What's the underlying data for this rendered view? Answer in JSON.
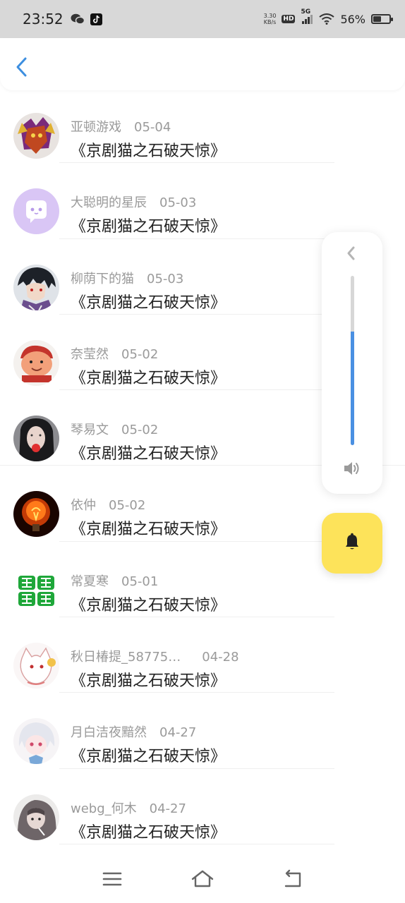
{
  "status_bar": {
    "time": "23:52",
    "left_icons": [
      "wechat-icon",
      "tiktok-icon"
    ],
    "net_speed_value": "3.30",
    "net_speed_unit": "KB/s",
    "hd_label": "HD",
    "network": "5G",
    "battery": "56%",
    "battery_level": 0.56
  },
  "header": {
    "back_icon": "chevron-left-icon"
  },
  "comments": [
    {
      "name": "亚顿游戏",
      "date": "05-04",
      "title": "《京剧猫之石破天惊》",
      "avatar": "game-character-avatar"
    },
    {
      "name": "大聪明的星辰",
      "date": "05-03",
      "title": "《京剧猫之石破天惊》",
      "avatar": "default-purple-avatar"
    },
    {
      "name": "柳荫下的猫",
      "date": "05-03",
      "title": "《京剧猫之石破天惊》",
      "avatar": "anime-boy-avatar"
    },
    {
      "name": "奈莹然",
      "date": "05-02",
      "title": "《京剧猫之石破天惊》",
      "avatar": "cartoon-face-avatar"
    },
    {
      "name": "琴易文",
      "date": "05-02",
      "title": "《京剧猫之石破天惊》",
      "avatar": "girl-photo-avatar"
    },
    {
      "name": "依仲",
      "date": "05-02",
      "title": "《京剧猫之石破天惊》",
      "avatar": "light-bulb-avatar"
    },
    {
      "name": "常夏寒",
      "date": "05-01",
      "title": "《京剧猫之石破天惊》",
      "avatar": "bbq-text-avatar",
      "avatar_text": "烧烤联盟"
    },
    {
      "name": "秋日椿提_58775…",
      "date": "04-28",
      "title": "《京剧猫之石破天惊》",
      "avatar": "white-creature-avatar"
    },
    {
      "name": "月白洁夜黯然",
      "date": "04-27",
      "title": "《京剧猫之石破天惊》",
      "avatar": "anime-girl-avatar"
    },
    {
      "name": "webg_何木",
      "date": "04-27",
      "title": "《京剧猫之石破天惊》",
      "avatar": "sketch-girl-avatar"
    }
  ],
  "volume_panel": {
    "level": 0.67,
    "collapse_icon": "chevron-left-icon",
    "speaker_icon": "speaker-icon"
  },
  "bell_button": {
    "icon": "bell-icon"
  },
  "nav_bar": {
    "buttons": [
      "menu-icon",
      "home-icon",
      "back-icon"
    ]
  },
  "colors": {
    "accent": "#4a90e2",
    "bell_bg": "#fde35a",
    "muted_text": "#9a9a9a",
    "status_bg": "#d8d8d8"
  }
}
